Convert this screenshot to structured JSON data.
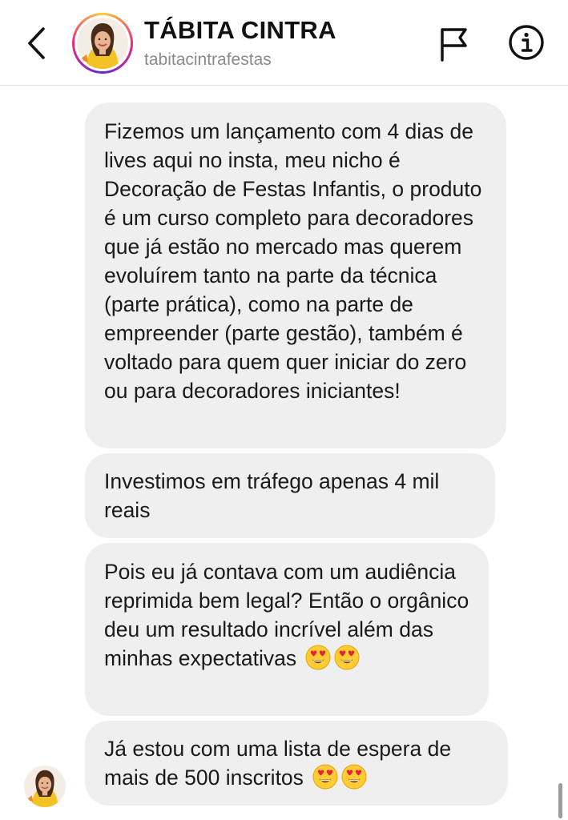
{
  "header": {
    "name": "TÁBITA CINTRA",
    "handle": "tabitacintrafestas",
    "icons": {
      "back": "chevron-left-icon",
      "report": "flag-icon",
      "info": "info-icon"
    }
  },
  "messages": [
    {
      "text": "Fizemos um lançamento com 4 dias de lives aqui no insta, meu nicho é Decoração de Festas Infantis, o produto é um curso completo para decoradores que já estão no mercado mas querem evoluírem tanto na parte da técnica (parte prática), como na parte de empreender (parte gestão), também é voltado para quem quer iniciar do zero ou para decoradores iniciantes!",
      "emojis": []
    },
    {
      "text": "Investimos em tráfego apenas 4 mil reais",
      "emojis": []
    },
    {
      "text": "Pois eu já contava com um audiência reprimida bem legal? Então o orgânico deu um resultado incrível além das minhas expectativas",
      "emojis": [
        "heart-eyes-emoji",
        "heart-eyes-emoji"
      ]
    },
    {
      "text": "Já estou com uma lista de espera de mais de 500 inscritos",
      "emojis": [
        "heart-eyes-emoji",
        "heart-eyes-emoji"
      ]
    }
  ],
  "colors": {
    "bubble": "#efefef",
    "text": "#1a1a1a",
    "handle": "#8a8a8a",
    "story_ring": [
      "#f9ce34",
      "#ee2a7b",
      "#6228d7"
    ]
  }
}
